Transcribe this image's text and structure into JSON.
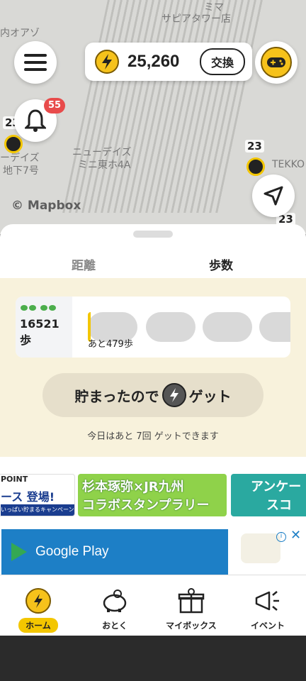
{
  "map": {
    "labels": [
      "内オアゾ",
      "サピアタワー店",
      "ミマ",
      "ニューデイズ",
      "ミニ東ホ4A",
      "ーデイズ",
      "地下7号",
      "TEKKO"
    ],
    "pins": [
      "23",
      "23",
      "23"
    ],
    "attribution": "© Mapbox"
  },
  "header": {
    "coins": "25,260",
    "exchange_label": "交換",
    "notification_count": "55"
  },
  "tabs": [
    {
      "label": "距離",
      "active": false
    },
    {
      "label": "歩数",
      "active": true
    }
  ],
  "steps": {
    "count": "16521",
    "unit": "歩",
    "remaining": "あと479歩",
    "progress_fraction": 0.04
  },
  "get_button": {
    "prefix": "貯まったので",
    "suffix": "ゲット"
  },
  "today_text": "今日はあと 7回 ゲットできます",
  "banners": [
    {
      "text_top": "POINT",
      "text_main": "ース 登場!",
      "text_sub": "いっぱい貯まるキャンペーン"
    },
    {
      "text_top": "杉本琢弥×JR九州",
      "text_main": "コラボスタンプラリー"
    },
    {
      "text_top": "アンケー",
      "text_main": "スコ"
    }
  ],
  "ad": {
    "label": "Google Play"
  },
  "bottom_nav": [
    {
      "label": "ホーム",
      "icon": "bolt-coin-icon",
      "active": true
    },
    {
      "label": "おとく",
      "icon": "piggy-bank-icon",
      "active": false
    },
    {
      "label": "マイボックス",
      "icon": "gift-box-icon",
      "active": false
    },
    {
      "label": "イベント",
      "icon": "megaphone-icon",
      "active": false
    }
  ],
  "colors": {
    "accent": "#f3c600",
    "panel_bg": "#f8f2dc",
    "badge": "#e84b4b"
  }
}
